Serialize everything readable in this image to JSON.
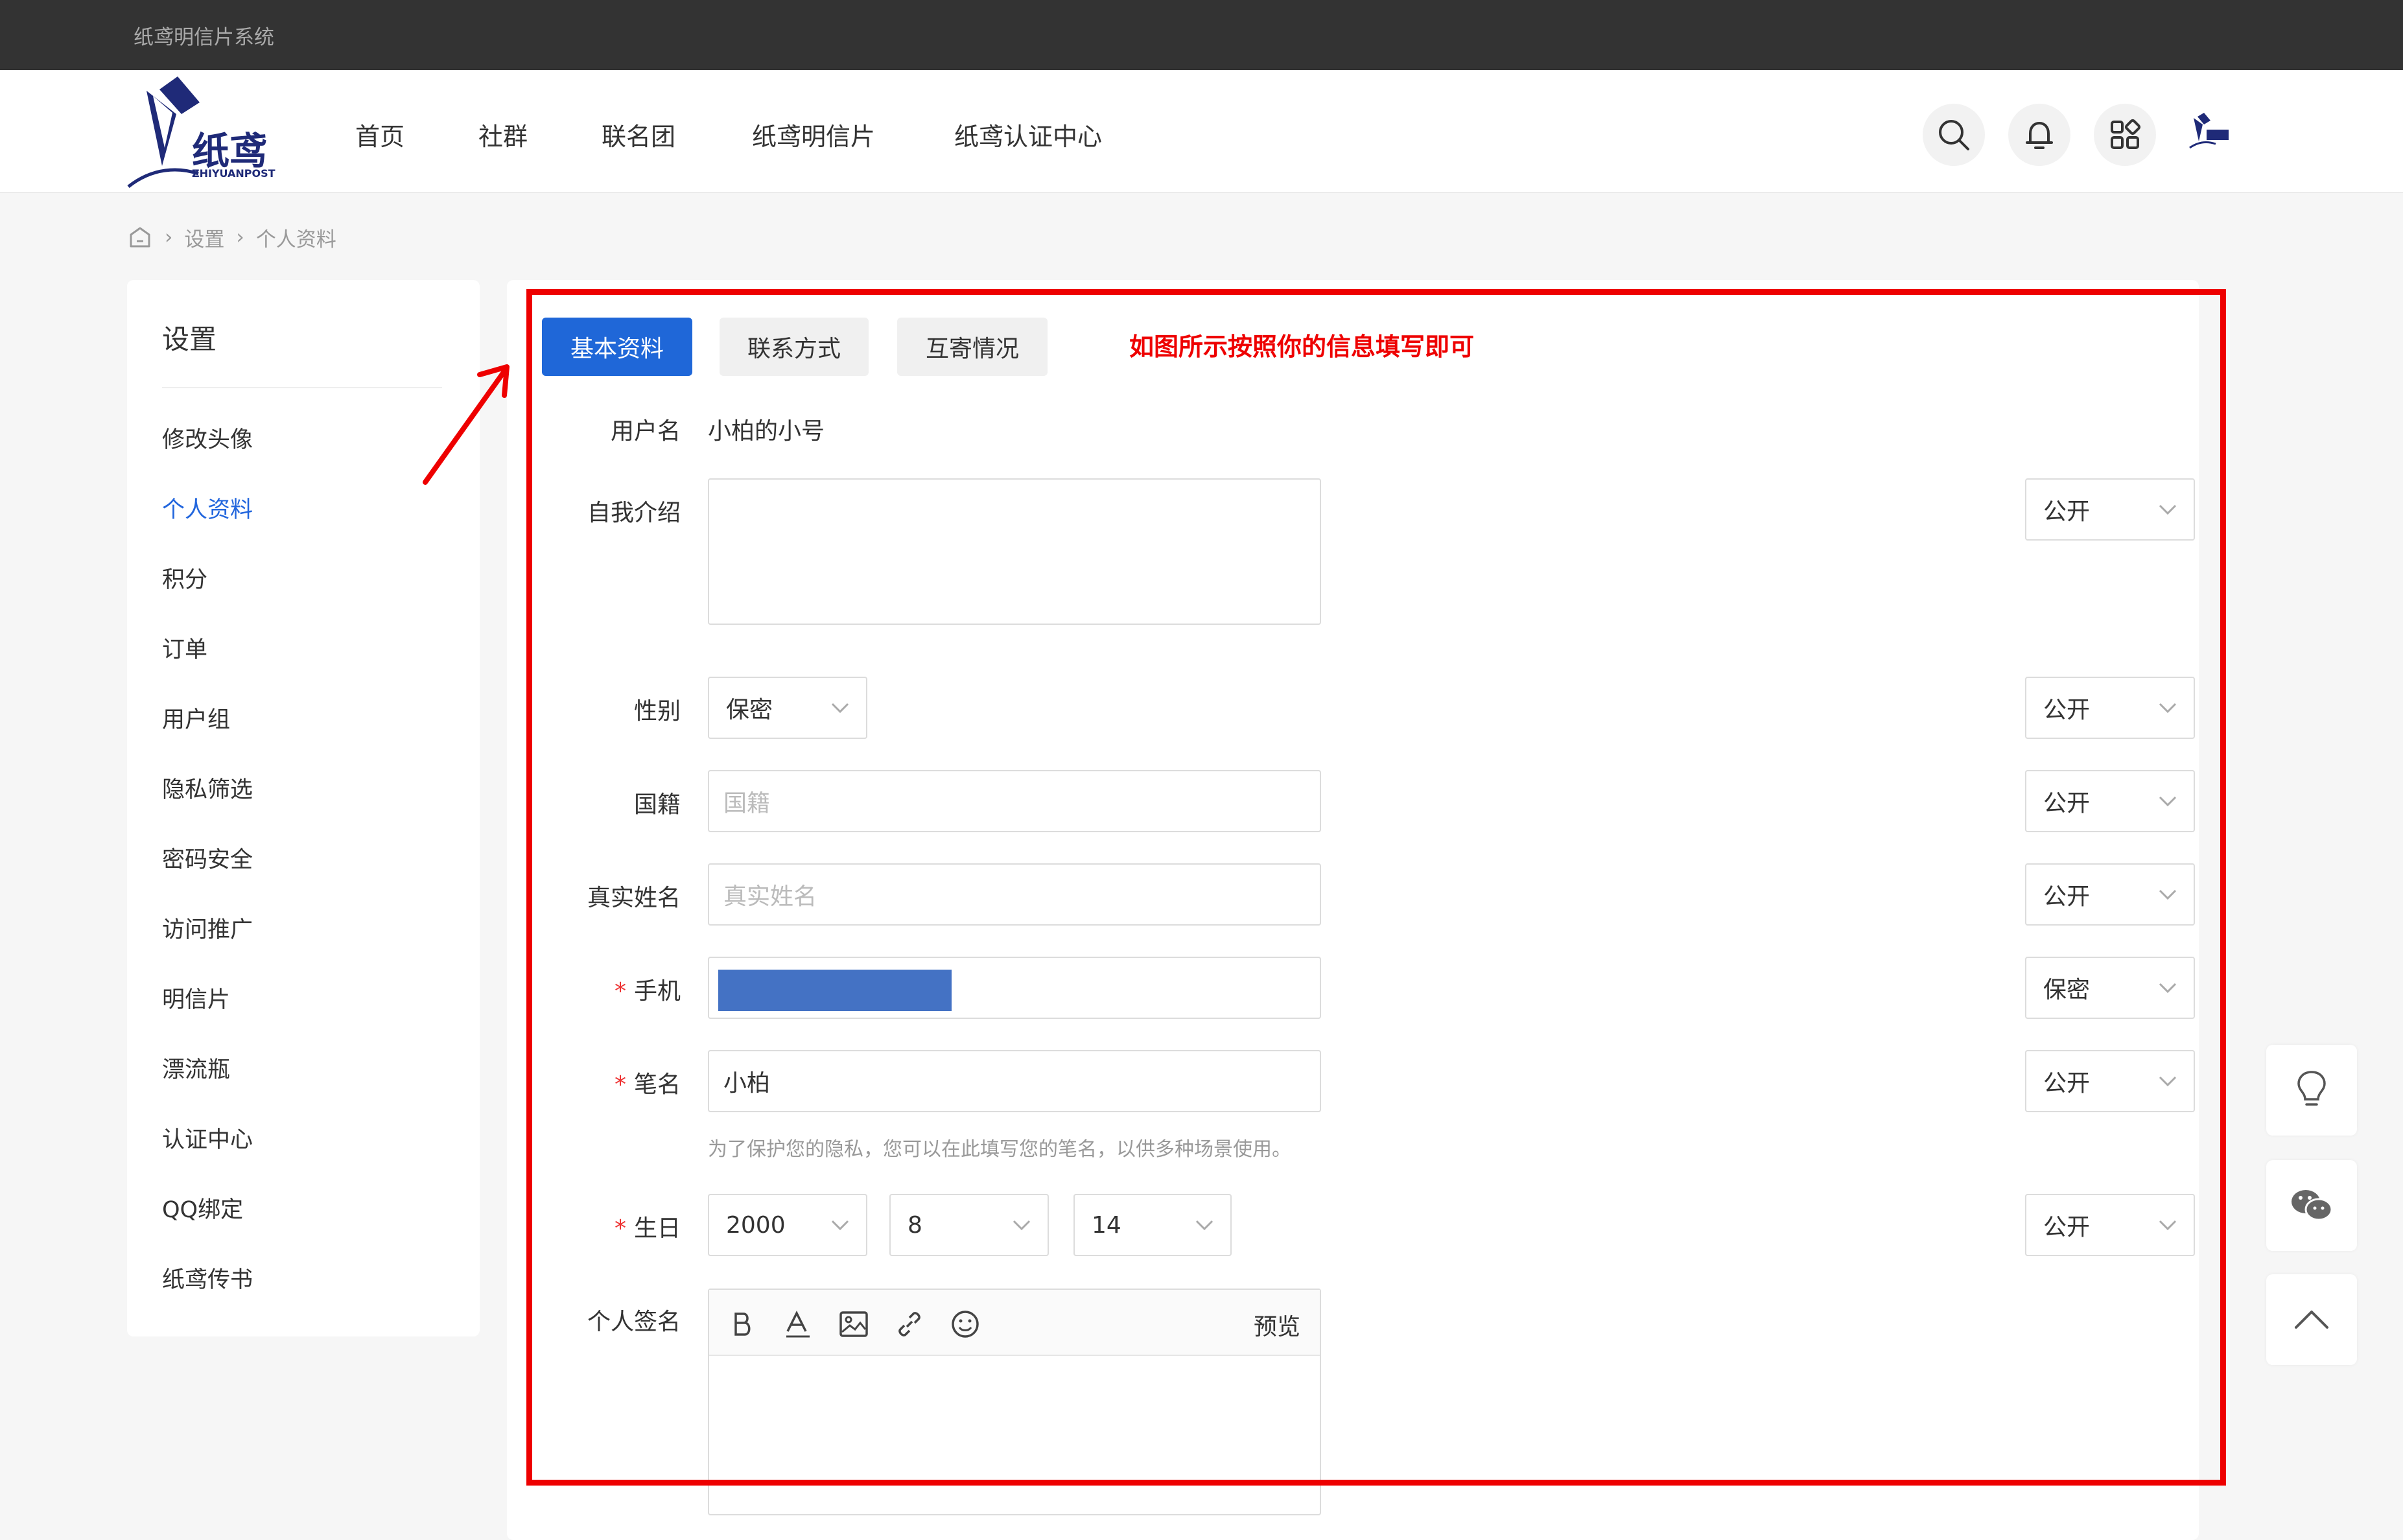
{
  "topbar": {
    "system_title": "纸鸢明信片系统"
  },
  "logo": {
    "text": "纸鸢",
    "sub": "ZHIYUANPOST"
  },
  "nav": {
    "items": [
      "首页",
      "社群",
      "联名团",
      "纸鸢明信片",
      "纸鸢认证中心"
    ]
  },
  "breadcrumb": {
    "items": [
      "设置",
      "个人资料"
    ]
  },
  "side": {
    "title": "设置",
    "items": [
      "修改头像",
      "个人资料",
      "积分",
      "订单",
      "用户组",
      "隐私筛选",
      "密码安全",
      "访问推广",
      "明信片",
      "漂流瓶",
      "认证中心",
      "QQ绑定",
      "纸鸢传书"
    ],
    "active": "个人资料"
  },
  "tabs": [
    "基本资料",
    "联系方式",
    "互寄情况"
  ],
  "annotation": "如图所示按照你的信息填写即可",
  "form": {
    "username_label": "用户名",
    "username_value": "小柏的小号",
    "intro_label": "自我介绍",
    "gender_label": "性别",
    "gender_value": "保密",
    "nationality_label": "国籍",
    "nationality_placeholder": "国籍",
    "realname_label": "真实姓名",
    "realname_placeholder": "真实姓名",
    "phone_label": "手机",
    "penname_label": "笔名",
    "penname_value": "小柏",
    "penname_hint": "为了保护您的隐私，您可以在此填写您的笔名，以供多种场景使用。",
    "birthday_label": "生日",
    "birth_year": "2000",
    "birth_month": "8",
    "birth_day": "14",
    "signature_label": "个人签名",
    "required_mark": "*",
    "privacy": {
      "intro": "公开",
      "gender": "公开",
      "nationality": "公开",
      "realname": "公开",
      "phone": "保密",
      "penname": "公开",
      "birthday": "公开"
    }
  },
  "editor": {
    "preview_label": "预览"
  },
  "colors": {
    "primary": "#1f67d8",
    "annotation": "#ee0000",
    "mask": "#4472c4"
  }
}
